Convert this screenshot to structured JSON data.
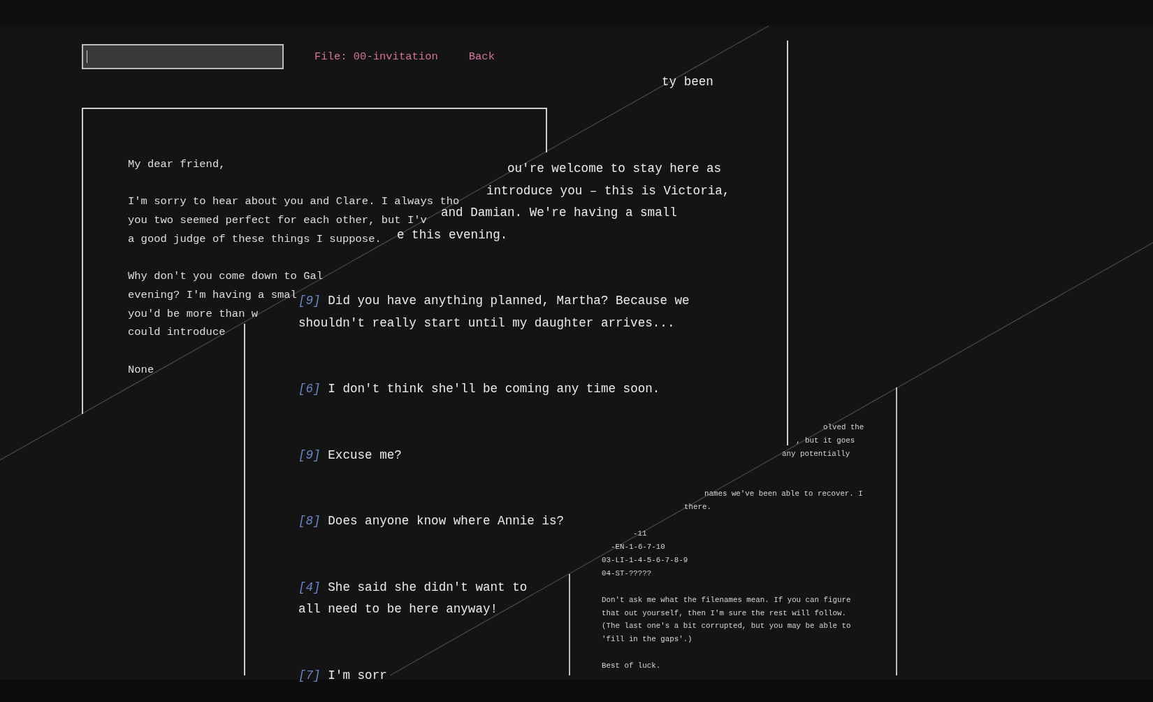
{
  "toolbar": {
    "file_label": "File: 00-invitation",
    "back_link": "Back"
  },
  "letter": {
    "paragraphs": [
      [
        "My dear friend,"
      ],
      [
        "I'm sorry to hear about you and Clare. I always tho",
        "you two seemed perfect for each other, but I'v",
        "a good judge of these things I suppose."
      ],
      [
        "Why don't you come down to Gal",
        "evening? I'm having a smal",
        "you'd be more than w",
        "could introduce"
      ],
      [
        "None"
      ]
    ]
  },
  "transcript": {
    "narration": [
      "ty been",
      "ou're welcome to stay here as",
      "introduce you – this is Victoria,",
      "and Damian. We're having a small",
      "e this evening."
    ],
    "entries": [
      {
        "number": "[9]",
        "lines": [
          "Did you have anything planned, Martha? Because we",
          "shouldn't really start until my daughter arrives..."
        ]
      },
      {
        "number": "[6]",
        "lines": [
          "I don't think she'll be coming any time soon."
        ]
      },
      {
        "number": "[9]",
        "lines": [
          "Excuse me?"
        ]
      },
      {
        "number": "[8]",
        "lines": [
          "Does anyone know where Annie is?"
        ]
      },
      {
        "number": "[4]",
        "lines": [
          "She said she didn't want to",
          "all need to be here anyway!"
        ]
      },
      {
        "number": "[7]",
        "lines": [
          "I'm sorr"
        ]
      }
    ]
  },
  "note": {
    "paragraphs": [
      [
        "olved the",
        ", but it goes",
        "any potentially"
      ],
      [
        "names we've been able to recover. I",
        "there."
      ],
      [
        "-11",
        "-EN-1-6-7-10",
        "03-LI-1-4-5-6-7-8-9",
        "04-ST-?????"
      ],
      [
        "Don't ask me what the filenames mean. If you can figure",
        "that out yourself, then I'm sure the rest will follow.",
        "(The last one's a bit corrupted, but you may be able to",
        "'fill in the gaps'.)"
      ],
      [
        "Best of luck."
      ]
    ]
  }
}
